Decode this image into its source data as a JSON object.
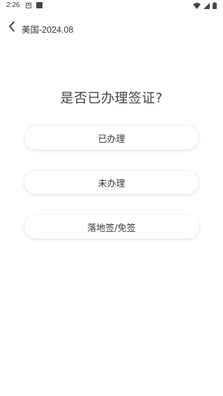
{
  "status_bar": {
    "time": "2:26",
    "notif_a_glyph": "A",
    "icons": [
      "wifi-icon",
      "signal-icon",
      "battery-icon"
    ]
  },
  "header": {
    "back_icon": "chevron-left-icon",
    "title": "美国-2024.08"
  },
  "question": "是否已办理签证?",
  "options": [
    {
      "label": "已办理"
    },
    {
      "label": "未办理"
    },
    {
      "label": "落地签/免签"
    }
  ],
  "colors": {
    "background": "#ffffff",
    "text": "#333333",
    "question_text": "#3a3f4a"
  }
}
